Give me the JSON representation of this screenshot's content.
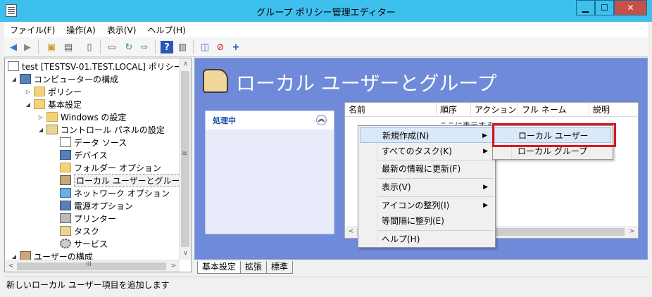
{
  "window": {
    "title": "グループ ポリシー管理エディター",
    "minimize": "▁",
    "maximize": "☐",
    "close": "✕"
  },
  "menubar": [
    "ファイル(F)",
    "操作(A)",
    "表示(V)",
    "ヘルプ(H)"
  ],
  "toolbar": {
    "icons": [
      "back-arrow-icon",
      "forward-arrow-icon",
      "up-folder-icon",
      "show-hide-tree-icon",
      "clipboard-icon",
      "print-icon",
      "refresh-icon",
      "export-icon",
      "help-icon",
      "action-pane-icon",
      "new-window-icon",
      "delete-icon",
      "add-icon"
    ]
  },
  "tree": [
    {
      "label": "test [TESTSV-01.TEST.LOCAL] ポリシー",
      "icon": "doc",
      "exp": ""
    },
    {
      "label": "コンピューターの構成",
      "icon": "comp",
      "exp": "◢"
    },
    {
      "label": "ポリシー",
      "icon": "folder",
      "exp": "▷"
    },
    {
      "label": "基本設定",
      "icon": "folder",
      "exp": "◢"
    },
    {
      "label": "Windows の設定",
      "icon": "folder",
      "exp": "▷"
    },
    {
      "label": "コントロール パネルの設定",
      "icon": "panel",
      "exp": "◢"
    },
    {
      "label": "データ ソース",
      "icon": "doc",
      "exp": ""
    },
    {
      "label": "デバイス",
      "icon": "comp",
      "exp": ""
    },
    {
      "label": "フォルダー オプション",
      "icon": "folder",
      "exp": ""
    },
    {
      "label": "ローカル ユーザーとグループ",
      "icon": "users",
      "exp": "",
      "selected": true
    },
    {
      "label": "ネットワーク オプション",
      "icon": "net",
      "exp": ""
    },
    {
      "label": "電源オプション",
      "icon": "comp",
      "exp": ""
    },
    {
      "label": "プリンター",
      "icon": "printer",
      "exp": ""
    },
    {
      "label": "タスク",
      "icon": "panel",
      "exp": ""
    },
    {
      "label": "サービス",
      "icon": "gear",
      "exp": ""
    },
    {
      "label": "ユーザーの構成",
      "icon": "users",
      "exp": "◢"
    }
  ],
  "tree_scroll": {
    "up": "∧",
    "down": "∨",
    "grip": "≡",
    "left": "<",
    "right": ">",
    "hgrip": "III"
  },
  "banner": {
    "title": "ローカル ユーザーとグループ"
  },
  "tasks": {
    "header": "処理中",
    "collapse": "︽"
  },
  "listview": {
    "columns": [
      "名前",
      "順序",
      "アクション",
      "フル ネーム",
      "説明"
    ],
    "partial_text": "ここに表示する",
    "scroll_left": "<",
    "scroll_right": ">"
  },
  "context_menu": {
    "items": [
      "新規作成(N)",
      "すべてのタスク(K)",
      "最新の情報に更新(F)",
      "表示(V)",
      "アイコンの整列(I)",
      "等間隔に整列(E)",
      "ヘルプ(H)"
    ],
    "submenu_arrow": "▶"
  },
  "submenu": {
    "items": [
      "ローカル ユーザー",
      "ローカル グループ"
    ]
  },
  "tabs": [
    "基本設定",
    "拡張",
    "標準"
  ],
  "statusbar": {
    "text": "新しいローカル ユーザー項目を追加します"
  },
  "colors": {
    "titlebar": "#3ec0ee",
    "pane_bg": "#6f8ad9",
    "highlight_box": "#e0151b"
  }
}
